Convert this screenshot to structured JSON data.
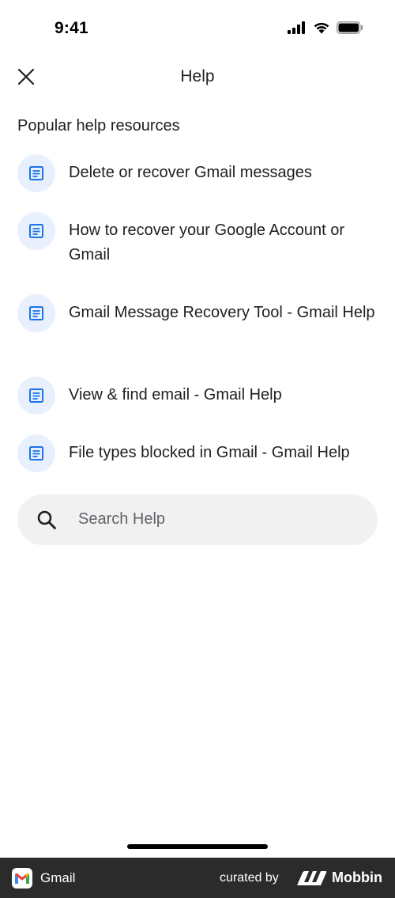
{
  "status_bar": {
    "time": "9:41",
    "icons": [
      "signal-icon",
      "wifi-icon",
      "battery-icon"
    ]
  },
  "header": {
    "close_icon": "close-icon",
    "title": "Help"
  },
  "section": {
    "title": "Popular help resources"
  },
  "resources": [
    {
      "icon": "document-icon",
      "label": "Delete or recover Gmail messages"
    },
    {
      "icon": "document-icon",
      "label": "How to recover your Google Account or Gmail"
    },
    {
      "icon": "document-icon",
      "label": "Gmail Message Recovery Tool - Gmail Help"
    },
    {
      "icon": "document-icon",
      "label": "View & find email - Gmail Help"
    },
    {
      "icon": "document-icon",
      "label": "File types blocked in Gmail - Gmail Help"
    }
  ],
  "search": {
    "icon": "search-icon",
    "placeholder": "Search Help"
  },
  "footer": {
    "app_name": "Gmail",
    "curated_by": "curated by",
    "brand": "Mobbin"
  },
  "colors": {
    "accent": "#1a73e8",
    "icon_bg": "#e8f0fe",
    "search_bg": "#f1f1f1",
    "footer_bg": "#2b2b2b"
  }
}
